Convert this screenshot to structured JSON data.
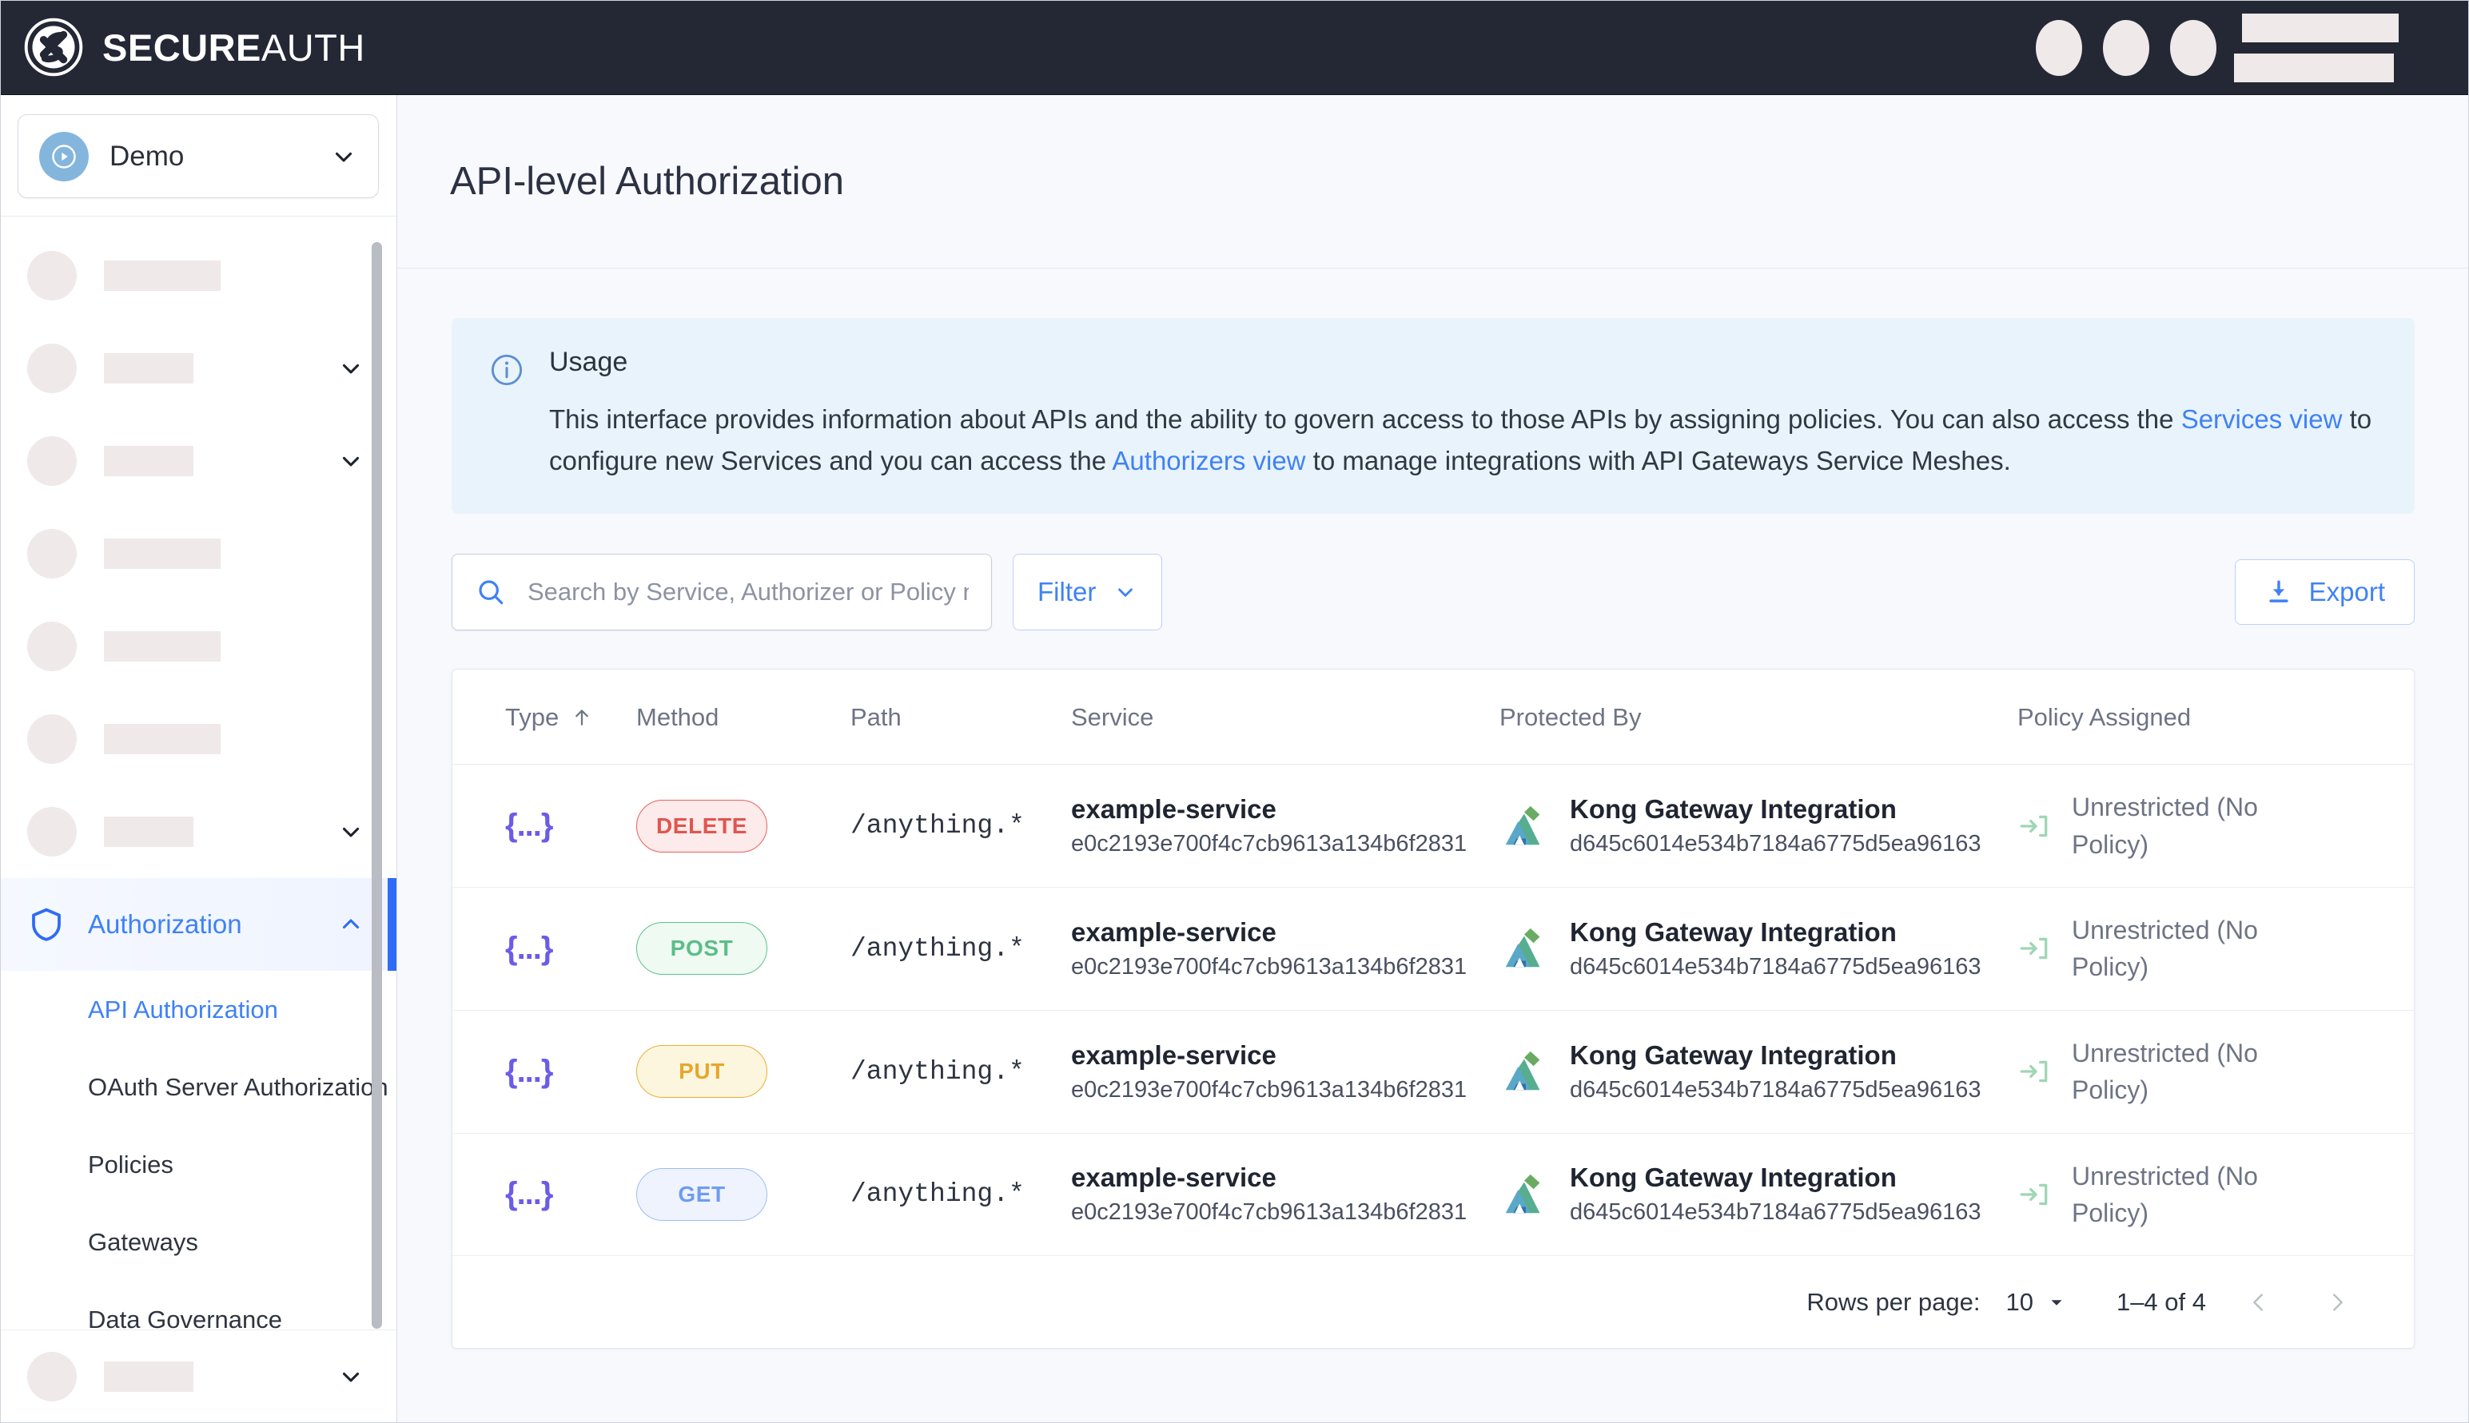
{
  "brand": {
    "bold": "SECURE",
    "light": "AUTH",
    "logo_icon": "secureauth-logo-icon"
  },
  "topbar": {
    "placeholder_circles": 3,
    "placeholder_bars": 2
  },
  "sidebar": {
    "tenant": {
      "name": "Demo",
      "avatar_icon": "play-circle-icon",
      "chevron_icon": "chevron-down-icon"
    },
    "placeholder_items": [
      {
        "has_chevron": false
      },
      {
        "has_chevron": true
      },
      {
        "has_chevron": true
      },
      {
        "has_chevron": false
      },
      {
        "has_chevron": false
      },
      {
        "has_chevron": false
      },
      {
        "has_chevron": true
      }
    ],
    "active_group": {
      "label": "Authorization",
      "icon": "shield-icon",
      "chevron_icon": "chevron-up-icon"
    },
    "sub_items": [
      {
        "label": "API Authorization",
        "selected": true
      },
      {
        "label": "OAuth Server Authorization",
        "selected": false
      },
      {
        "label": "Policies",
        "selected": false
      },
      {
        "label": "Gateways",
        "selected": false
      },
      {
        "label": "Data Governance",
        "selected": false
      }
    ],
    "bottom_placeholder": {
      "has_chevron": true
    }
  },
  "page": {
    "title": "API-level Authorization"
  },
  "usage": {
    "icon": "info-icon",
    "title": "Usage",
    "text_1": "This interface provides information about APIs and the ability to govern access to those APIs by assigning policies. You can also access the ",
    "link_1": "Services view",
    "text_2": " to configure new Services and you can access the ",
    "link_2": "Authorizers view",
    "text_3": " to manage integrations with API Gateways Service Meshes."
  },
  "toolbar": {
    "search_placeholder": "Search by Service, Authorizer or Policy na",
    "search_value": "",
    "search_icon": "search-icon",
    "filter_label": "Filter",
    "filter_chevron_icon": "chevron-down-icon",
    "export_label": "Export",
    "export_icon": "download-icon"
  },
  "table": {
    "columns": [
      {
        "key": "type",
        "label": "Type",
        "sorted": true,
        "sort_icon": "arrow-up-icon"
      },
      {
        "key": "method",
        "label": "Method"
      },
      {
        "key": "path",
        "label": "Path"
      },
      {
        "key": "service",
        "label": "Service"
      },
      {
        "key": "protected_by",
        "label": "Protected By"
      },
      {
        "key": "policy",
        "label": "Policy Assigned"
      }
    ],
    "rows": [
      {
        "type_icon": "{...}",
        "method": "DELETE",
        "path": "/anything.*",
        "service_name": "example-service",
        "service_id": "e0c2193e700f4c7cb9613a134b6f2831",
        "protected_icon": "kong-logo-icon",
        "protected_name": "Kong Gateway Integration",
        "protected_id": "d645c6014e534b7184a6775d5ea96163",
        "policy_icon": "login-arrow-icon",
        "policy": "Unrestricted (No Policy)"
      },
      {
        "type_icon": "{...}",
        "method": "POST",
        "path": "/anything.*",
        "service_name": "example-service",
        "service_id": "e0c2193e700f4c7cb9613a134b6f2831",
        "protected_icon": "kong-logo-icon",
        "protected_name": "Kong Gateway Integration",
        "protected_id": "d645c6014e534b7184a6775d5ea96163",
        "policy_icon": "login-arrow-icon",
        "policy": "Unrestricted (No Policy)"
      },
      {
        "type_icon": "{...}",
        "method": "PUT",
        "path": "/anything.*",
        "service_name": "example-service",
        "service_id": "e0c2193e700f4c7cb9613a134b6f2831",
        "protected_icon": "kong-logo-icon",
        "protected_name": "Kong Gateway Integration",
        "protected_id": "d645c6014e534b7184a6775d5ea96163",
        "policy_icon": "login-arrow-icon",
        "policy": "Unrestricted (No Policy)"
      },
      {
        "type_icon": "{...}",
        "method": "GET",
        "path": "/anything.*",
        "service_name": "example-service",
        "service_id": "e0c2193e700f4c7cb9613a134b6f2831",
        "protected_icon": "kong-logo-icon",
        "protected_name": "Kong Gateway Integration",
        "protected_id": "d645c6014e534b7184a6775d5ea96163",
        "policy_icon": "login-arrow-icon",
        "policy": "Unrestricted (No Policy)"
      }
    ]
  },
  "pagination": {
    "rows_per_page_label": "Rows per page:",
    "rows_per_page_value": "10",
    "range_label": "1–4 of 4",
    "prev_icon": "chevron-left-icon",
    "next_icon": "chevron-right-icon"
  },
  "colors": {
    "topbar_bg": "#242835",
    "accent_blue": "#3f82f6",
    "delete": "#e0564f",
    "post": "#5cbd88",
    "put": "#e8a62c",
    "get": "#6f9cf1",
    "type_purple": "#6b5ce8",
    "usage_bg": "#e9f3fb"
  }
}
